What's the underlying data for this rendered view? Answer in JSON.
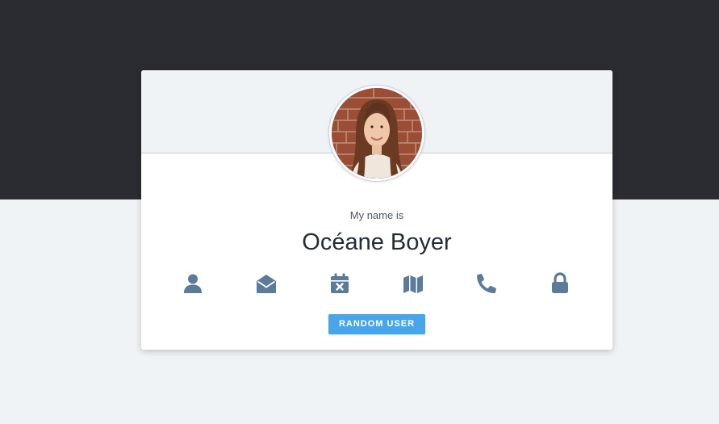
{
  "profile": {
    "label": "My name is",
    "value": "Océane Boyer"
  },
  "icons": [
    {
      "name": "user-icon"
    },
    {
      "name": "envelope-open-icon"
    },
    {
      "name": "calendar-times-icon"
    },
    {
      "name": "map-icon"
    },
    {
      "name": "phone-icon"
    },
    {
      "name": "lock-icon"
    }
  ],
  "button": {
    "label": "RANDOM USER"
  },
  "colors": {
    "top_background": "#2a2c31",
    "page_background": "#f0f3f6",
    "icon": "#5b7b9a",
    "button": "#47a6ea",
    "name_text": "#232c36"
  }
}
